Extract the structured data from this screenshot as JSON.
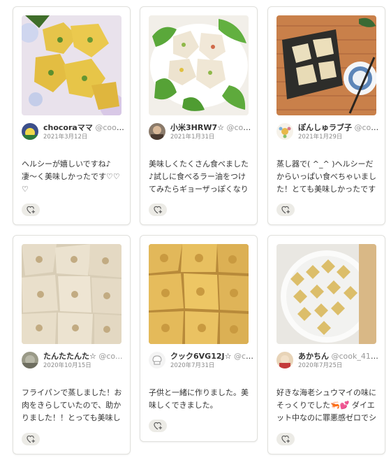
{
  "cards": [
    {
      "name": "chocoraママ",
      "handle": "@cook_...",
      "date": "2021年3月12日",
      "comment": "ヘルシーが嬉しいですね♪凄〜く美味しかったです♡♡♡",
      "image": "shumai-flower-plate-photo"
    },
    {
      "name": "小米3HRW7☆",
      "handle": "@coo...",
      "date": "2021年1月31日",
      "comment": "美味しくたくさん食べました♪試しに食べるラー油をつけてみたらギョーザっぽくなりこれま…",
      "image": "shumai-lettuce-plate-photo"
    },
    {
      "name": "ぽんしゅラブ子",
      "handle": "@cook...",
      "date": "2021年1月29日",
      "comment": "蒸し器で( ^_^ )ヘルシーだからいっぱい食べちゃいました！とても美味しかったです♡♡…",
      "image": "shumai-bamboo-mat-photo"
    },
    {
      "name": "たんたたんた☆",
      "handle": "@co...",
      "date": "2020年10月15日",
      "comment": "フライパンで蒸しました！お肉をきらしていたので、助かりました！！とっても美味しかった…",
      "image": "shumai-steamed-closeup-photo"
    },
    {
      "name": "クック6VG12J☆",
      "handle": "@co...",
      "date": "2020年7月31日",
      "comment": "子供と一緒に作りました。美味しくできました。",
      "image": "shumai-golden-closeup-photo"
    },
    {
      "name": "あかちん",
      "handle": "@cook_411...",
      "date": "2020年7月25日",
      "comment": "好きな海老シュウマイの味にそっくりでした🦐💕 ダイエット中なのに罪悪感ゼロでシュウマ…",
      "image": "shumai-white-plate-photo"
    }
  ],
  "icons": {
    "like": "heart-plus-icon"
  },
  "colors": {
    "card_border": "#e0e0dc",
    "like_bg": "#ecebe6",
    "handle_text": "#999999"
  }
}
